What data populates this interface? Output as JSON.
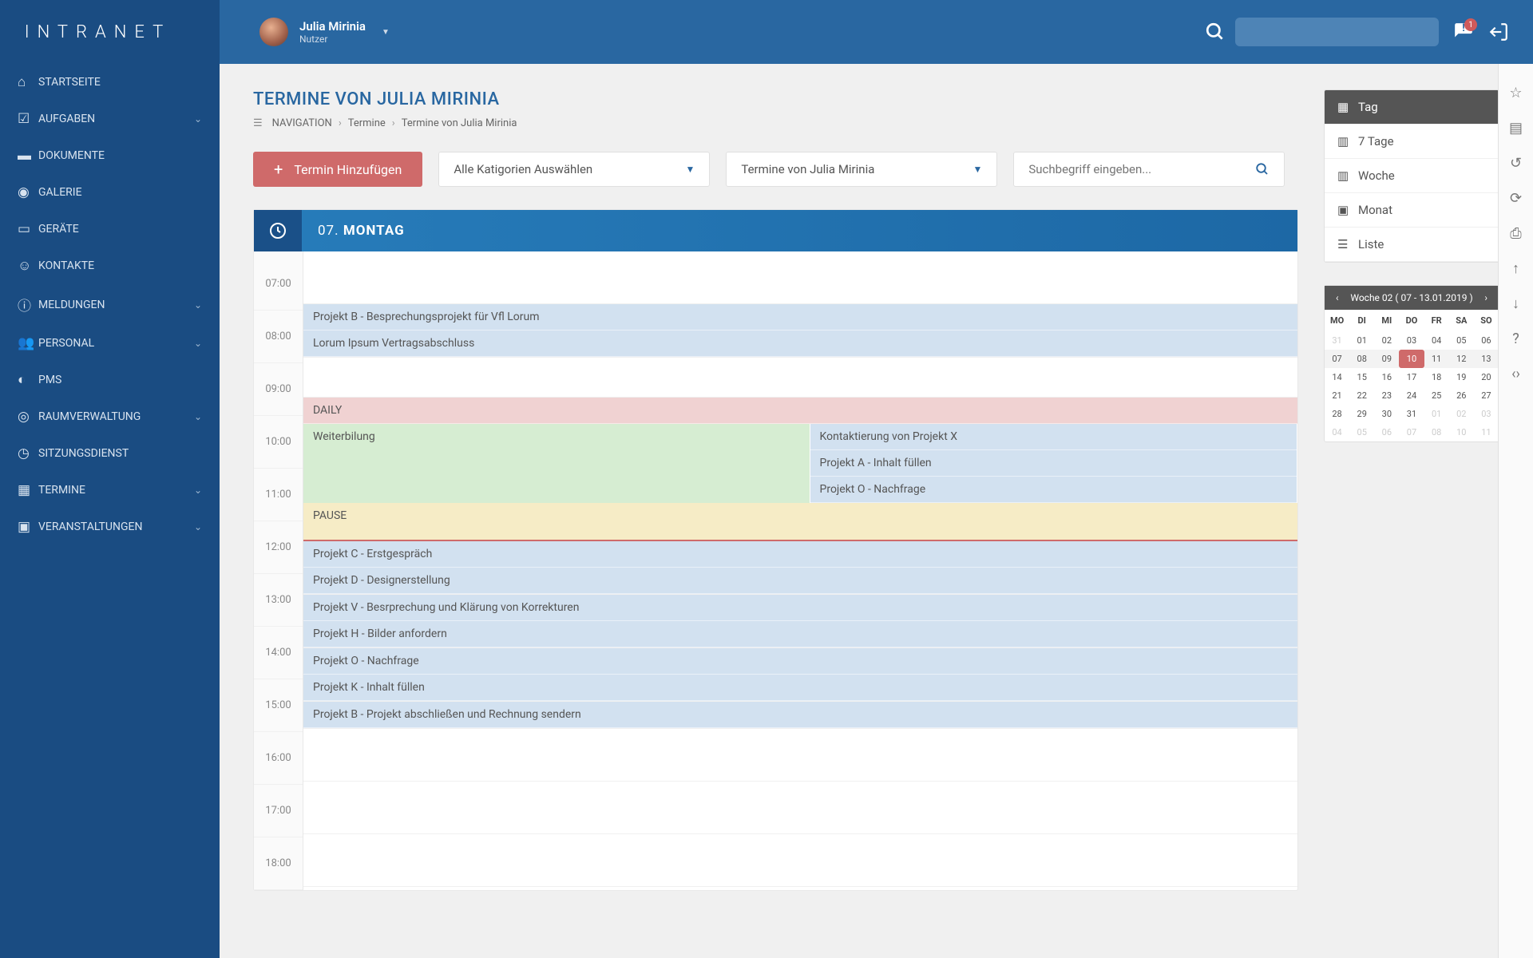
{
  "brand": "INTRANET",
  "user": {
    "name": "Julia Mirinia",
    "role": "Nutzer"
  },
  "nav": [
    {
      "label": "STARTSEITE",
      "icon": "home",
      "exp": false
    },
    {
      "label": "AUFGABEN",
      "icon": "task",
      "exp": true
    },
    {
      "label": "DOKUMENTE",
      "icon": "folder",
      "exp": false
    },
    {
      "label": "GALERIE",
      "icon": "camera",
      "exp": false
    },
    {
      "label": "GERÄTE",
      "icon": "laptop",
      "exp": false
    },
    {
      "label": "KONTAKTE",
      "icon": "smile",
      "exp": false
    },
    {
      "label": "MELDUNGEN",
      "icon": "info",
      "exp": true
    },
    {
      "label": "PERSONAL",
      "icon": "people",
      "exp": true
    },
    {
      "label": "PMS",
      "icon": "sync",
      "exp": false
    },
    {
      "label": "RAUMVERWALTUNG",
      "icon": "pin",
      "exp": true
    },
    {
      "label": "SITZUNGSDIENST",
      "icon": "clock",
      "exp": false
    },
    {
      "label": "TERMINE",
      "icon": "calendar",
      "exp": true
    },
    {
      "label": "VERANSTALTUNGEN",
      "icon": "event",
      "exp": true
    }
  ],
  "page_title": "TERMINE VON JULIA MIRINIA",
  "breadcrumb": {
    "nav": "NAVIGATION",
    "a": "Termine",
    "b": "Termine von Julia Mirinia"
  },
  "toolbar": {
    "add": "Termin Hinzufügen",
    "filter_cat": "Alle Katigorien Auswählen",
    "filter_view": "Termine von Julia Mirinia",
    "search_ph": "Suchbegriff eingeben..."
  },
  "day": {
    "date": "07.",
    "name": "MONTAG"
  },
  "hours": [
    "07:00",
    "08:00",
    "09:00",
    "10:00",
    "11:00",
    "12:00",
    "13:00",
    "14:00",
    "15:00",
    "16:00",
    "17:00",
    "18:00"
  ],
  "events": {
    "h07": [],
    "h08": [
      {
        "c": "blue",
        "t": "Projekt B - Besprechungsprojekt für Vfl Lorum"
      },
      {
        "c": "blue",
        "t": "Lorum Ipsum Vertragsabschluss"
      }
    ],
    "h09": [],
    "daily": "DAILY",
    "wb": "Weiterbilung",
    "r1": "Kontaktierung von Projekt X",
    "r2": "Projekt A - Inhalt füllen",
    "r3": "Projekt O - Nachfrage",
    "pause": "PAUSE",
    "h12": [
      {
        "c": "blue",
        "t": "Projekt C - Erstgespräch"
      }
    ],
    "h13": [
      {
        "c": "blue",
        "t": "Projekt D - Designerstellung"
      },
      {
        "c": "blue",
        "t": "Projekt V - Besrprechung und Klärung von Korrekturen"
      }
    ],
    "h14": [
      {
        "c": "blue",
        "t": "Projekt H - Bilder anfordern"
      },
      {
        "c": "blue",
        "t": "Projekt O - Nachfrage"
      }
    ],
    "h15": [
      {
        "c": "blue",
        "t": "Projekt K - Inhalt füllen"
      },
      {
        "c": "blue",
        "t": "Projekt B - Projekt abschließen und Rechnung sendern"
      }
    ]
  },
  "views": [
    {
      "l": "Tag",
      "a": true
    },
    {
      "l": "7 Tage",
      "a": false
    },
    {
      "l": "Woche",
      "a": false
    },
    {
      "l": "Monat",
      "a": false
    },
    {
      "l": "Liste",
      "a": false
    }
  ],
  "mini": {
    "title": "Woche 02 ( 07 - 13.01.2019 )",
    "dh": [
      "MO",
      "DI",
      "MI",
      "DO",
      "FR",
      "SA",
      "SO"
    ],
    "rows": [
      [
        {
          "d": "31",
          "dim": true
        },
        {
          "d": "01"
        },
        {
          "d": "02"
        },
        {
          "d": "03"
        },
        {
          "d": "04"
        },
        {
          "d": "05"
        },
        {
          "d": "06"
        }
      ],
      [
        {
          "d": "07",
          "wk": true
        },
        {
          "d": "08",
          "wk": true
        },
        {
          "d": "09",
          "wk": true
        },
        {
          "d": "10",
          "today": true
        },
        {
          "d": "11",
          "wk": true
        },
        {
          "d": "12",
          "wk": true
        },
        {
          "d": "13",
          "wk": true
        }
      ],
      [
        {
          "d": "14"
        },
        {
          "d": "15"
        },
        {
          "d": "16"
        },
        {
          "d": "17"
        },
        {
          "d": "18"
        },
        {
          "d": "19"
        },
        {
          "d": "20"
        }
      ],
      [
        {
          "d": "21"
        },
        {
          "d": "22"
        },
        {
          "d": "23"
        },
        {
          "d": "24"
        },
        {
          "d": "25"
        },
        {
          "d": "26"
        },
        {
          "d": "27"
        }
      ],
      [
        {
          "d": "28"
        },
        {
          "d": "29"
        },
        {
          "d": "30"
        },
        {
          "d": "31"
        },
        {
          "d": "01",
          "dim": true
        },
        {
          "d": "02",
          "dim": true
        },
        {
          "d": "03",
          "dim": true
        }
      ],
      [
        {
          "d": "04",
          "dim": true
        },
        {
          "d": "05",
          "dim": true
        },
        {
          "d": "06",
          "dim": true
        },
        {
          "d": "07",
          "dim": true
        },
        {
          "d": "08",
          "dim": true
        },
        {
          "d": "10",
          "dim": true
        },
        {
          "d": "11",
          "dim": true
        }
      ]
    ]
  },
  "notif_count": "1"
}
